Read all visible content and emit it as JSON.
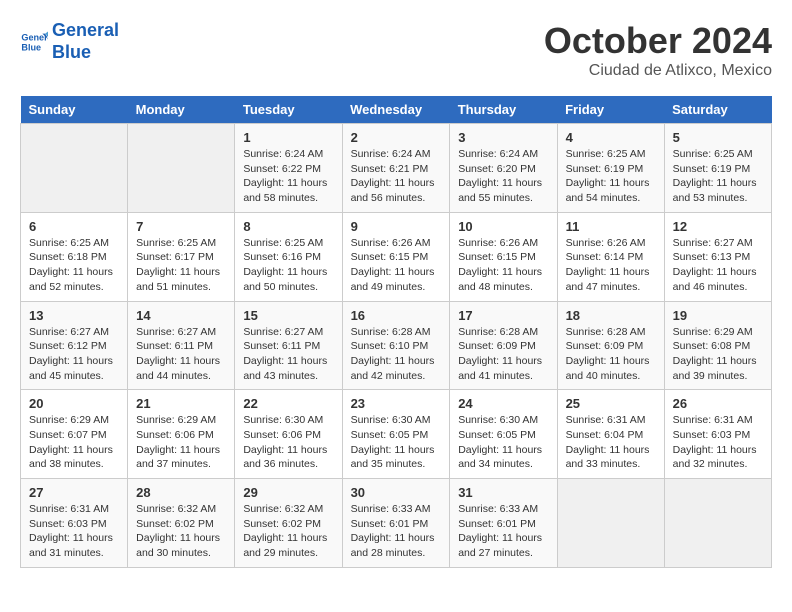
{
  "logo": {
    "line1": "General",
    "line2": "Blue"
  },
  "title": "October 2024",
  "location": "Ciudad de Atlixco, Mexico",
  "weekdays": [
    "Sunday",
    "Monday",
    "Tuesday",
    "Wednesday",
    "Thursday",
    "Friday",
    "Saturday"
  ],
  "weeks": [
    [
      {
        "day": "",
        "info": ""
      },
      {
        "day": "",
        "info": ""
      },
      {
        "day": "1",
        "info": "Sunrise: 6:24 AM\nSunset: 6:22 PM\nDaylight: 11 hours and 58 minutes."
      },
      {
        "day": "2",
        "info": "Sunrise: 6:24 AM\nSunset: 6:21 PM\nDaylight: 11 hours and 56 minutes."
      },
      {
        "day": "3",
        "info": "Sunrise: 6:24 AM\nSunset: 6:20 PM\nDaylight: 11 hours and 55 minutes."
      },
      {
        "day": "4",
        "info": "Sunrise: 6:25 AM\nSunset: 6:19 PM\nDaylight: 11 hours and 54 minutes."
      },
      {
        "day": "5",
        "info": "Sunrise: 6:25 AM\nSunset: 6:19 PM\nDaylight: 11 hours and 53 minutes."
      }
    ],
    [
      {
        "day": "6",
        "info": "Sunrise: 6:25 AM\nSunset: 6:18 PM\nDaylight: 11 hours and 52 minutes."
      },
      {
        "day": "7",
        "info": "Sunrise: 6:25 AM\nSunset: 6:17 PM\nDaylight: 11 hours and 51 minutes."
      },
      {
        "day": "8",
        "info": "Sunrise: 6:25 AM\nSunset: 6:16 PM\nDaylight: 11 hours and 50 minutes."
      },
      {
        "day": "9",
        "info": "Sunrise: 6:26 AM\nSunset: 6:15 PM\nDaylight: 11 hours and 49 minutes."
      },
      {
        "day": "10",
        "info": "Sunrise: 6:26 AM\nSunset: 6:15 PM\nDaylight: 11 hours and 48 minutes."
      },
      {
        "day": "11",
        "info": "Sunrise: 6:26 AM\nSunset: 6:14 PM\nDaylight: 11 hours and 47 minutes."
      },
      {
        "day": "12",
        "info": "Sunrise: 6:27 AM\nSunset: 6:13 PM\nDaylight: 11 hours and 46 minutes."
      }
    ],
    [
      {
        "day": "13",
        "info": "Sunrise: 6:27 AM\nSunset: 6:12 PM\nDaylight: 11 hours and 45 minutes."
      },
      {
        "day": "14",
        "info": "Sunrise: 6:27 AM\nSunset: 6:11 PM\nDaylight: 11 hours and 44 minutes."
      },
      {
        "day": "15",
        "info": "Sunrise: 6:27 AM\nSunset: 6:11 PM\nDaylight: 11 hours and 43 minutes."
      },
      {
        "day": "16",
        "info": "Sunrise: 6:28 AM\nSunset: 6:10 PM\nDaylight: 11 hours and 42 minutes."
      },
      {
        "day": "17",
        "info": "Sunrise: 6:28 AM\nSunset: 6:09 PM\nDaylight: 11 hours and 41 minutes."
      },
      {
        "day": "18",
        "info": "Sunrise: 6:28 AM\nSunset: 6:09 PM\nDaylight: 11 hours and 40 minutes."
      },
      {
        "day": "19",
        "info": "Sunrise: 6:29 AM\nSunset: 6:08 PM\nDaylight: 11 hours and 39 minutes."
      }
    ],
    [
      {
        "day": "20",
        "info": "Sunrise: 6:29 AM\nSunset: 6:07 PM\nDaylight: 11 hours and 38 minutes."
      },
      {
        "day": "21",
        "info": "Sunrise: 6:29 AM\nSunset: 6:06 PM\nDaylight: 11 hours and 37 minutes."
      },
      {
        "day": "22",
        "info": "Sunrise: 6:30 AM\nSunset: 6:06 PM\nDaylight: 11 hours and 36 minutes."
      },
      {
        "day": "23",
        "info": "Sunrise: 6:30 AM\nSunset: 6:05 PM\nDaylight: 11 hours and 35 minutes."
      },
      {
        "day": "24",
        "info": "Sunrise: 6:30 AM\nSunset: 6:05 PM\nDaylight: 11 hours and 34 minutes."
      },
      {
        "day": "25",
        "info": "Sunrise: 6:31 AM\nSunset: 6:04 PM\nDaylight: 11 hours and 33 minutes."
      },
      {
        "day": "26",
        "info": "Sunrise: 6:31 AM\nSunset: 6:03 PM\nDaylight: 11 hours and 32 minutes."
      }
    ],
    [
      {
        "day": "27",
        "info": "Sunrise: 6:31 AM\nSunset: 6:03 PM\nDaylight: 11 hours and 31 minutes."
      },
      {
        "day": "28",
        "info": "Sunrise: 6:32 AM\nSunset: 6:02 PM\nDaylight: 11 hours and 30 minutes."
      },
      {
        "day": "29",
        "info": "Sunrise: 6:32 AM\nSunset: 6:02 PM\nDaylight: 11 hours and 29 minutes."
      },
      {
        "day": "30",
        "info": "Sunrise: 6:33 AM\nSunset: 6:01 PM\nDaylight: 11 hours and 28 minutes."
      },
      {
        "day": "31",
        "info": "Sunrise: 6:33 AM\nSunset: 6:01 PM\nDaylight: 11 hours and 27 minutes."
      },
      {
        "day": "",
        "info": ""
      },
      {
        "day": "",
        "info": ""
      }
    ]
  ]
}
